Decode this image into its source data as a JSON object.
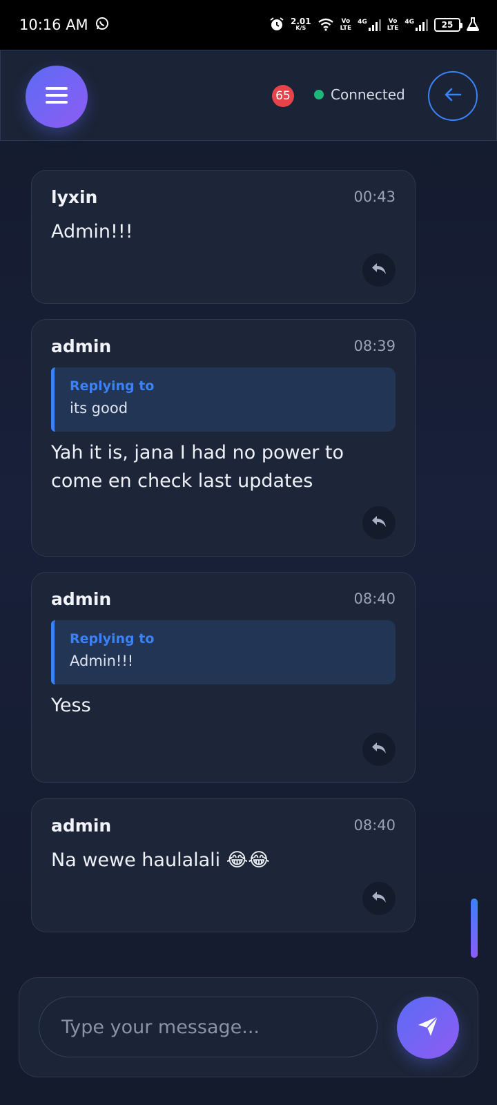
{
  "status_bar": {
    "time": "10:16 AM",
    "speed_value": "2.01",
    "speed_unit": "K/S",
    "net1_top": "Vo",
    "net1_bottom": "LTE",
    "net1_gen": "4G",
    "net2_top": "Vo",
    "net2_bottom": "LTE",
    "net2_gen": "4G",
    "battery": "25"
  },
  "header": {
    "badge_count": "65",
    "connection_status": "Connected",
    "accent": "#3b82f6",
    "connected_color": "#1fb67a"
  },
  "messages": [
    {
      "sender": "lyxin",
      "time": "00:43",
      "text": "Admin!!!"
    },
    {
      "sender": "admin",
      "time": "08:39",
      "reply_label": "Replying to",
      "reply_text": "its good",
      "text": "Yah it is, jana I had no power to come en check last updates"
    },
    {
      "sender": "admin",
      "time": "08:40",
      "reply_label": "Replying to",
      "reply_text": "Admin!!!",
      "text": "Yess"
    },
    {
      "sender": "admin",
      "time": "08:40",
      "text": "Na wewe haulalali 😂😂"
    }
  ],
  "composer": {
    "placeholder": "Type your message...",
    "value": ""
  },
  "icons": {
    "menu": "hamburger-icon",
    "back": "arrow-left-icon",
    "reply": "reply-icon",
    "send": "send-icon"
  }
}
